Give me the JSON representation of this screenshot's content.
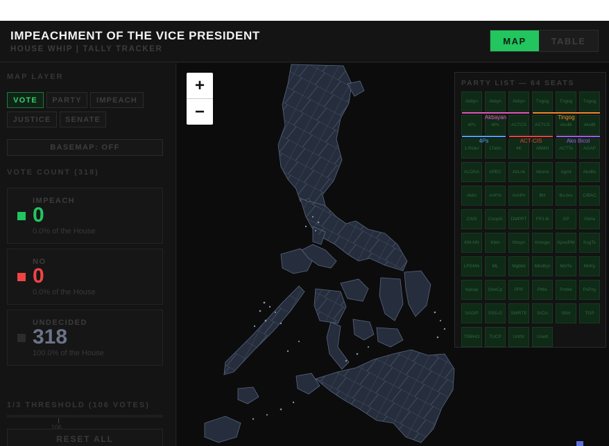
{
  "header": {
    "title": "IMPEACHMENT OF THE VICE PRESIDENT",
    "subtitle": "HOUSE WHIP | TALLY TRACKER",
    "view_map": "MAP",
    "view_table": "TABLE"
  },
  "sidebar": {
    "map_layer_label": "MAP LAYER",
    "layers": [
      "VOTE",
      "PARTY",
      "IMPEACH",
      "JUSTICE",
      "SENATE"
    ],
    "active_layer": "VOTE",
    "basemap": "BASEMAP: OFF",
    "vote_count_label": "VOTE COUNT (318)",
    "counts": {
      "impeach": {
        "label": "IMPEACH",
        "value": "0",
        "pct": "0.0% of the House"
      },
      "no": {
        "label": "NO",
        "value": "0",
        "pct": "0.0% of the House"
      },
      "undecided": {
        "label": "UNDECIDED",
        "value": "318",
        "pct": "100.0% of the House"
      }
    },
    "threshold_label": "1/3 THRESHOLD (106 VOTES)",
    "threshold_tick": "106",
    "reset": "RESET ALL"
  },
  "map": {
    "zoom_in": "+",
    "zoom_out": "−"
  },
  "party_list": {
    "title": "PARTY LIST — 64 SEATS",
    "rows": [
      [
        "Akbyn",
        "Akbyn",
        "Akbyn",
        "Tngog",
        "Tngog",
        "Tngog"
      ],
      [
        "4Ps",
        "4Ps",
        "ACTCS",
        "ACTCS",
        "AkoBl",
        "AkoBl"
      ],
      [
        "1-Rider",
        "1Tahn",
        "4K",
        "ABMN",
        "ACTTe",
        "AGAP"
      ],
      [
        "ALONA",
        "APEC",
        "AbLnk",
        "Abono",
        "Agmt",
        "AkoBs"
      ],
      [
        "Aklio",
        "AnFrb",
        "AsnPn",
        "BH",
        "Bs-bro",
        "CIBAC"
      ],
      [
        "CWS",
        "CoopN",
        "DMPPT",
        "FPJ-B",
        "GP",
        "Gbrla"
      ],
      [
        "KM-NN",
        "Kbtn",
        "Kbsyn",
        "Kmngw",
        "KpsoPM",
        "KsgTs"
      ],
      [
        "LPGMA",
        "ML",
        "Mgbbk",
        "MksByn",
        "MnlTe",
        "MnKy"
      ],
      [
        "Nanay",
        "OneCp",
        "PPP",
        "Pltbs",
        "Pmlkk",
        "PsPny"
      ],
      [
        "SAGIP",
        "SSS-G",
        "SWRTE",
        "SrCts",
        "SNrt",
        "TGP"
      ],
      [
        "TRBHO",
        "TUCP",
        "UntSr",
        "Uswlt"
      ]
    ],
    "groups": [
      {
        "name": "Akbayan",
        "color": "#e35bb8"
      },
      {
        "name": "Tingog",
        "color": "#f08a2c"
      },
      {
        "name": "4Ps",
        "color": "#4aa3ea"
      },
      {
        "name": "ACT-CIS",
        "color": "#e0473d"
      },
      {
        "name": "Ako Bicol",
        "color": "#9a5fe3"
      }
    ]
  },
  "colors": {
    "impeach": "#22c55e",
    "no": "#ef4444",
    "undecided": "#2c2c2c",
    "undecided_text": "#6b7488",
    "accent": "#22c55e"
  }
}
